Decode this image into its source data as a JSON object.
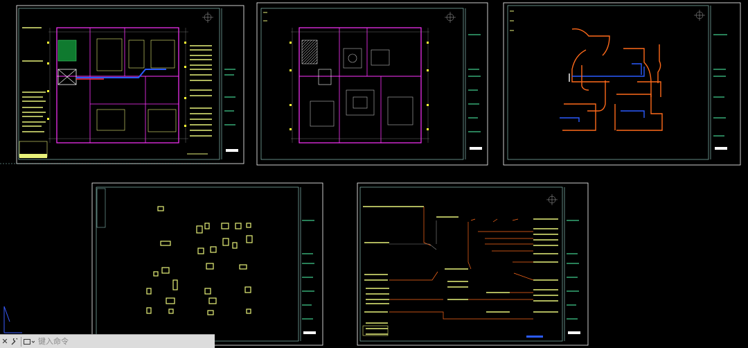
{
  "app": {
    "view": "model-space"
  },
  "command_line": {
    "placeholder": "键入命令",
    "close_icon": "close-icon",
    "customize_icon": "wrench-icon",
    "recent_icon": "command-history-icon"
  },
  "colors": {
    "frame": "#ffffff",
    "frame_cyan": "#9fe0d6",
    "wall_magenta": "#ff33ff",
    "text_yellow": "#e8f27a",
    "text_green": "#4fffb0",
    "pipe_orange": "#ff6a1a",
    "pipe_blue": "#2b5bff",
    "dim_yellow": "#ffff33",
    "gray_line": "#8a8a8a"
  },
  "sheets": [
    {
      "id": "sheet-1",
      "kind": "plumbing-plan"
    },
    {
      "id": "sheet-2",
      "kind": "furniture-plan"
    },
    {
      "id": "sheet-3",
      "kind": "pipe-system-diagram"
    },
    {
      "id": "sheet-4",
      "kind": "fixture-layout"
    },
    {
      "id": "sheet-5",
      "kind": "riser-diagram"
    }
  ]
}
